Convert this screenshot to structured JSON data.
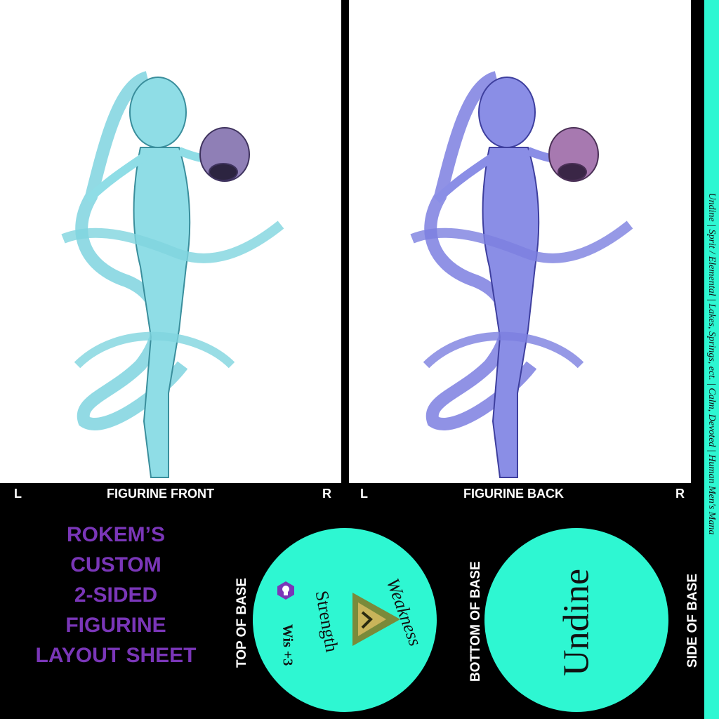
{
  "front": {
    "left_marker": "L",
    "label": "FIGURINE FRONT",
    "right_marker": "R"
  },
  "back": {
    "left_marker": "L",
    "label": "FIGURINE BACK",
    "right_marker": "R"
  },
  "title_lines": [
    "ROKEM’S",
    "CUSTOM",
    "2-SIDED",
    "FIGURINE",
    "LAYOUT SHEET"
  ],
  "base_labels": {
    "top": "TOP OF BASE",
    "bottom": "BOTTOM OF BASE",
    "side": "SIDE OF BASE"
  },
  "top_base": {
    "weakness": "Weakness",
    "strength": "Strength",
    "stat": "Wis +3"
  },
  "bottom_base": {
    "name": "Undine"
  },
  "side_stripe": {
    "text": "Undine | Sprit / Elemental | Lakes, Springs, ect. | Calm, Devoted | Human Men's Mana"
  },
  "colors": {
    "accent": "#2ef7d2",
    "title": "#7a36b8",
    "front_tint": "#7fd9e0",
    "back_tint": "#7c7fe0"
  },
  "icons": {
    "stat_icon": "purple-hexagon-bulb-icon",
    "weakness_icon": "triangle-emblem-icon"
  }
}
